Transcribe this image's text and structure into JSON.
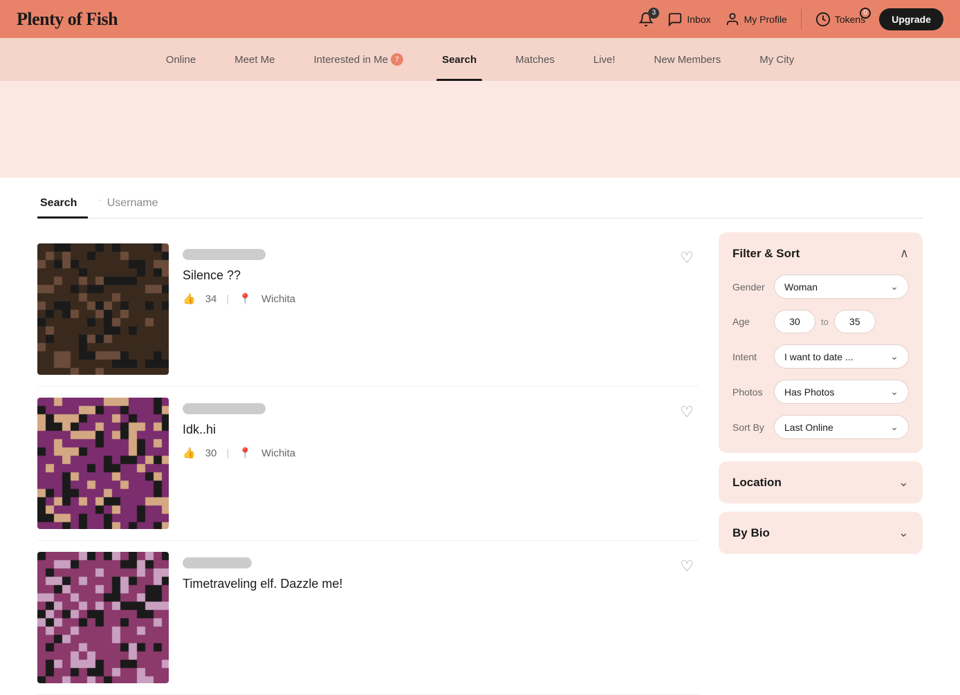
{
  "header": {
    "logo": "Plenty of Fish",
    "notifications_count": "3",
    "inbox_label": "Inbox",
    "profile_label": "My Profile",
    "tokens_label": "Tokens",
    "tokens_count": "0",
    "upgrade_label": "Upgrade"
  },
  "nav": {
    "items": [
      {
        "id": "online",
        "label": "Online",
        "active": false,
        "badge": null
      },
      {
        "id": "meet-me",
        "label": "Meet Me",
        "active": false,
        "badge": null
      },
      {
        "id": "interested-in-me",
        "label": "Interested in Me",
        "active": false,
        "badge": "7"
      },
      {
        "id": "search",
        "label": "Search",
        "active": true,
        "badge": null
      },
      {
        "id": "matches",
        "label": "Matches",
        "active": false,
        "badge": null
      },
      {
        "id": "live",
        "label": "Live!",
        "active": false,
        "badge": null
      },
      {
        "id": "new-members",
        "label": "New Members",
        "active": false,
        "badge": null
      },
      {
        "id": "my-city",
        "label": "My City",
        "active": false,
        "badge": null
      }
    ]
  },
  "search_tabs": [
    {
      "id": "search",
      "label": "Search",
      "active": true
    },
    {
      "id": "username",
      "label": "Username",
      "active": false
    }
  ],
  "results": [
    {
      "id": 1,
      "username_placeholder": true,
      "name": "Silence ??",
      "age": "34",
      "location": "Wichita",
      "photo_color1": "#6b4c3b",
      "photo_color2": "#3a2a1e"
    },
    {
      "id": 2,
      "username_placeholder": true,
      "name": "Idk..hi",
      "age": "30",
      "location": "Wichita",
      "photo_color1": "#d4a882",
      "photo_color2": "#7b2d6e"
    },
    {
      "id": 3,
      "username_placeholder": true,
      "name": "Timetraveling elf. Dazzle me!",
      "age": "",
      "location": "",
      "photo_color1": "#c9a0c0",
      "photo_color2": "#8b3a6b"
    }
  ],
  "filter": {
    "title": "Filter & Sort",
    "gender_label": "Gender",
    "gender_value": "Woman",
    "age_label": "Age",
    "age_from": "30",
    "age_to": "35",
    "age_to_label": "to",
    "intent_label": "Intent",
    "intent_value": "I want to date ...",
    "photos_label": "Photos",
    "photos_value": "Has Photos",
    "sort_label": "Sort By",
    "sort_value": "Last Online"
  },
  "location_panel": {
    "title": "Location"
  },
  "bio_panel": {
    "title": "By Bio"
  }
}
